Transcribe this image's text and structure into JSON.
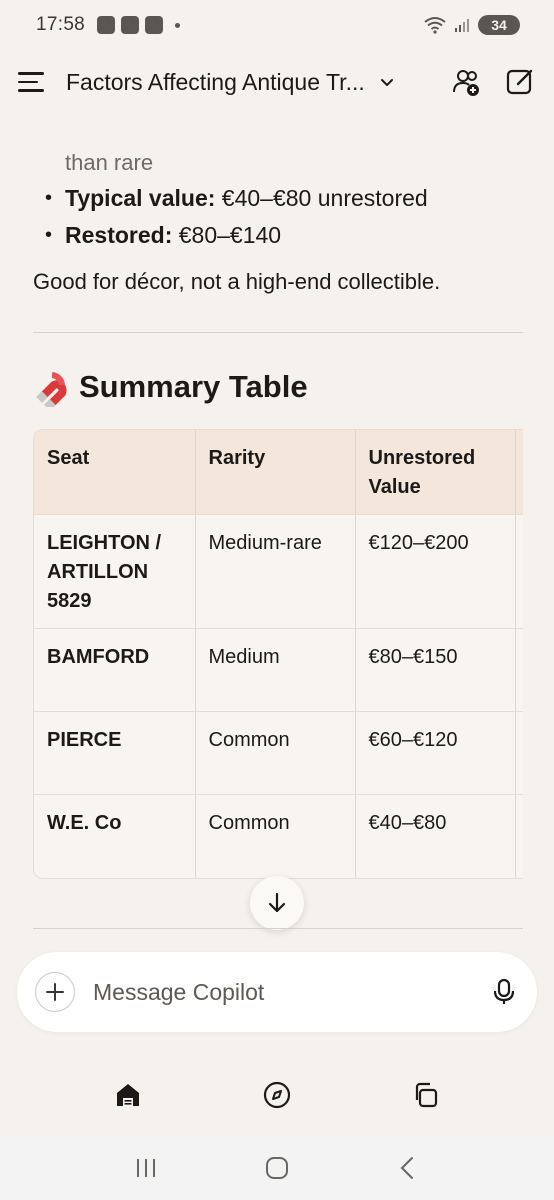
{
  "status_bar": {
    "time": "17:58",
    "battery": "34"
  },
  "header": {
    "title": "Factors Affecting Antique Tr...",
    "menu_icon": "menu-icon",
    "chevron_icon": "chevron-down-icon",
    "new_chat_icon": "add-people-icon",
    "edit_icon": "compose-icon"
  },
  "content": {
    "partial_line": "than rare",
    "bullets": [
      {
        "bold": "Typical value:",
        "text": " €40–€80 unrestored"
      },
      {
        "bold": "Restored:",
        "text": " €80–€140"
      }
    ],
    "paragraph": "Good for décor, not a high-end collectible.",
    "section_title": "Summary Table",
    "section_icon": "magnet-icon"
  },
  "table": {
    "headers": [
      "Seat",
      "Rarity",
      "Unrestored Value",
      ""
    ],
    "rows": [
      {
        "seat": "LEIGHTON / ARTILLON 5829",
        "rarity": "Medium-rare",
        "value": "€120–€200"
      },
      {
        "seat": "BAMFORD",
        "rarity": "Medium",
        "value": "€80–€150"
      },
      {
        "seat": "PIERCE",
        "rarity": "Common",
        "value": "€60–€120"
      },
      {
        "seat": "W.E. Co",
        "rarity": "Common",
        "value": "€40–€80"
      }
    ]
  },
  "composer": {
    "placeholder": "Message Copilot"
  },
  "bottom_nav": [
    "home-icon",
    "discover-icon",
    "pages-icon"
  ],
  "colors": {
    "background": "#f5f1ec",
    "table_header": "#f4e6da",
    "text": "#1c1a18"
  }
}
